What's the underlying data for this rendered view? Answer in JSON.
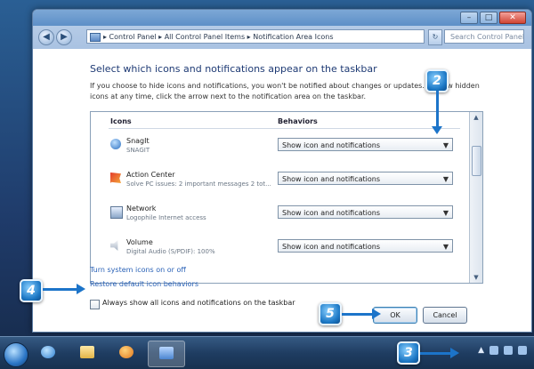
{
  "window": {
    "address_path": "▸ Control Panel ▸ All Control Panel Items ▸ Notification Area Icons",
    "search_placeholder": "Search Control Panel",
    "caption": {
      "minimize": "–",
      "maximize": "□",
      "close": "✕"
    }
  },
  "page": {
    "heading": "Select which icons and notifications appear on the taskbar",
    "description": "If you choose to hide icons and notifications, you won't be notified about changes or updates. To view hidden icons at any time, click the arrow next to the notification area on the taskbar.",
    "columns": {
      "icons": "Icons",
      "behaviors": "Behaviors"
    },
    "rows": [
      {
        "name": "SnagIt",
        "sub": "SNAGIT",
        "behavior": "Show icon and notifications"
      },
      {
        "name": "Action Center",
        "sub": "Solve PC issues: 2 important messages 2 tot...",
        "behavior": "Show icon and notifications"
      },
      {
        "name": "Network",
        "sub": "Logophile Internet access",
        "behavior": "Show icon and notifications"
      },
      {
        "name": "Volume",
        "sub": "Digital Audio (S/PDIF): 100%",
        "behavior": "Show icon and notifications"
      }
    ],
    "links": {
      "system_icons": "Turn system icons on or off",
      "restore": "Restore default icon behaviors"
    },
    "always_show_label": "Always show all icons and notifications on the taskbar",
    "ok_label": "OK",
    "cancel_label": "Cancel"
  },
  "callouts": {
    "c2": "2",
    "c3": "3",
    "c4": "4",
    "c5": "5"
  },
  "colors": {
    "callout": "#1d79c6",
    "link": "#2a62b7",
    "heading": "#1e3a74"
  }
}
